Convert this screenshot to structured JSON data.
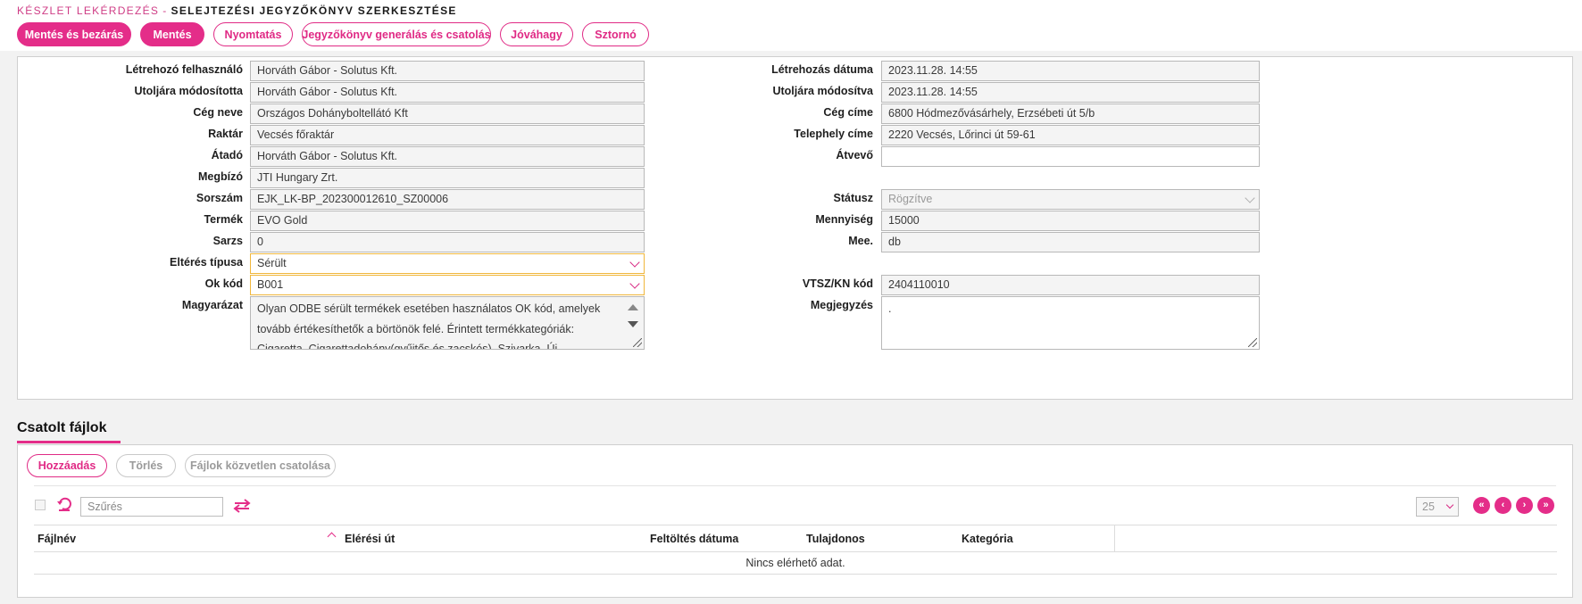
{
  "breadcrumb": {
    "parent": "Készlet lekérdezés",
    "separator": "-",
    "current": "Selejtezési jegyzőkönyv szerkesztése"
  },
  "toolbar": {
    "save_close": "Mentés és bezárás",
    "save": "Mentés",
    "print": "Nyomtatás",
    "generate_attach": "Jegyzőkönyv generálás és csatolás",
    "approve": "Jóváhagy",
    "cancel": "Sztornó"
  },
  "form": {
    "left": {
      "creator": {
        "label": "Létrehozó felhasználó",
        "value": "Horváth Gábor - Solutus Kft."
      },
      "last_modified_by": {
        "label": "Utoljára módosította",
        "value": "Horváth Gábor - Solutus Kft."
      },
      "company_name": {
        "label": "Cég neve",
        "value": "Országos Dohányboltellátó Kft"
      },
      "warehouse": {
        "label": "Raktár",
        "value": "Vecsés főraktár"
      },
      "handover": {
        "label": "Átadó",
        "value": "Horváth Gábor - Solutus Kft."
      },
      "principal": {
        "label": "Megbízó",
        "value": "JTI Hungary Zrt."
      },
      "serial": {
        "label": "Sorszám",
        "value": "EJK_LK-BP_202300012610_SZ00006"
      },
      "product": {
        "label": "Termék",
        "value": "EVO Gold"
      },
      "batch": {
        "label": "Sarzs",
        "value": "0"
      },
      "deviation_type": {
        "label": "Eltérés típusa",
        "value": "Sérült"
      },
      "reason_code": {
        "label": "Ok kód",
        "value": "B001"
      },
      "explanation": {
        "label": "Magyarázat",
        "value": "Olyan ODBE sérült termékek esetében használatos OK kód, amelyek tovább értékesíthetők a börtönök felé. Érintett termékkategóriák: Cigaretta, Cigarettadohány(gyűjtős és zacskós), Szivarka, Új dohánytermék-kategóriák"
      }
    },
    "right": {
      "created_date": {
        "label": "Létrehozás dátuma",
        "value": "2023.11.28. 14:55"
      },
      "modified_date": {
        "label": "Utoljára módosítva",
        "value": "2023.11.28. 14:55"
      },
      "company_address": {
        "label": "Cég címe",
        "value": "6800 Hódmezővásárhely, Erzsébeti út 5/b"
      },
      "site_address": {
        "label": "Telephely címe",
        "value": "2220 Vecsés, Lőrinci út 59-61"
      },
      "receiver": {
        "label": "Átvevő",
        "value": ""
      },
      "status": {
        "label": "Státusz",
        "value": "Rögzítve"
      },
      "quantity": {
        "label": "Mennyiség",
        "value": "15000"
      },
      "unit": {
        "label": "Mee.",
        "value": "db"
      },
      "vtsz": {
        "label": "VTSZ/KN kód",
        "value": "2404110010"
      },
      "note": {
        "label": "Megjegyzés",
        "value": "."
      }
    }
  },
  "files": {
    "title": "Csatolt fájlok",
    "add": "Hozzáadás",
    "delete": "Törlés",
    "direct_attach": "Fájlok közvetlen csatolása",
    "filter_placeholder": "Szűrés",
    "page_size": "25",
    "columns": [
      "Fájlnév",
      "Elérési út",
      "Feltöltés dátuma",
      "Tulajdonos",
      "Kategória"
    ],
    "empty_text": "Nincs elérhető adat.",
    "pager": {
      "first": "«",
      "prev": "‹",
      "next": "›",
      "last": "»"
    }
  },
  "colors": {
    "accent": "#e42d89",
    "select_border": "#f0b73c"
  },
  "icons": [
    "refresh-icon",
    "swap-icon",
    "chevron-down-icon",
    "sort-asc-icon"
  ]
}
